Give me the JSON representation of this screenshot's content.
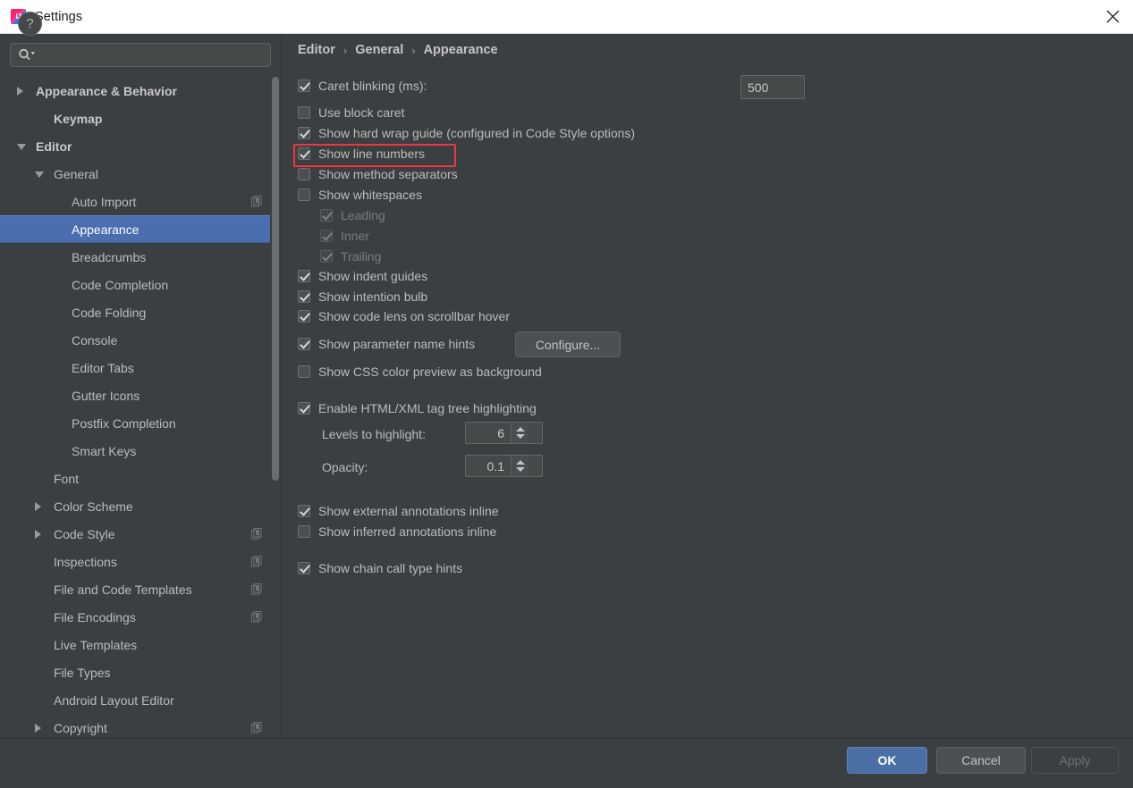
{
  "window": {
    "title": "Settings",
    "app_icon": "intellij-idea-icon",
    "close_icon": "close-icon"
  },
  "sidebar": {
    "search": {
      "placeholder": "",
      "value": "",
      "icon": "search-icon",
      "dropdown_icon": "chevron-down-icon"
    },
    "items": [
      {
        "label": "Appearance & Behavior",
        "indent": 0,
        "arrow": "right",
        "bold": true,
        "selected": false,
        "config_icon": false
      },
      {
        "label": "Keymap",
        "indent": 1,
        "arrow": "none",
        "bold": true,
        "selected": false,
        "config_icon": false
      },
      {
        "label": "Editor",
        "indent": 0,
        "arrow": "down",
        "bold": true,
        "selected": false,
        "config_icon": false
      },
      {
        "label": "General",
        "indent": 1,
        "arrow": "down",
        "bold": false,
        "selected": false,
        "config_icon": false
      },
      {
        "label": "Auto Import",
        "indent": 2,
        "arrow": "none",
        "bold": false,
        "selected": false,
        "config_icon": true
      },
      {
        "label": "Appearance",
        "indent": 2,
        "arrow": "none",
        "bold": false,
        "selected": true,
        "config_icon": false
      },
      {
        "label": "Breadcrumbs",
        "indent": 2,
        "arrow": "none",
        "bold": false,
        "selected": false,
        "config_icon": false
      },
      {
        "label": "Code Completion",
        "indent": 2,
        "arrow": "none",
        "bold": false,
        "selected": false,
        "config_icon": false
      },
      {
        "label": "Code Folding",
        "indent": 2,
        "arrow": "none",
        "bold": false,
        "selected": false,
        "config_icon": false
      },
      {
        "label": "Console",
        "indent": 2,
        "arrow": "none",
        "bold": false,
        "selected": false,
        "config_icon": false
      },
      {
        "label": "Editor Tabs",
        "indent": 2,
        "arrow": "none",
        "bold": false,
        "selected": false,
        "config_icon": false
      },
      {
        "label": "Gutter Icons",
        "indent": 2,
        "arrow": "none",
        "bold": false,
        "selected": false,
        "config_icon": false
      },
      {
        "label": "Postfix Completion",
        "indent": 2,
        "arrow": "none",
        "bold": false,
        "selected": false,
        "config_icon": false
      },
      {
        "label": "Smart Keys",
        "indent": 2,
        "arrow": "none",
        "bold": false,
        "selected": false,
        "config_icon": false
      },
      {
        "label": "Font",
        "indent": 1,
        "arrow": "none",
        "bold": false,
        "selected": false,
        "config_icon": false
      },
      {
        "label": "Color Scheme",
        "indent": 1,
        "arrow": "right",
        "bold": false,
        "selected": false,
        "config_icon": false
      },
      {
        "label": "Code Style",
        "indent": 1,
        "arrow": "right",
        "bold": false,
        "selected": false,
        "config_icon": true
      },
      {
        "label": "Inspections",
        "indent": 1,
        "arrow": "none",
        "bold": false,
        "selected": false,
        "config_icon": true
      },
      {
        "label": "File and Code Templates",
        "indent": 1,
        "arrow": "none",
        "bold": false,
        "selected": false,
        "config_icon": true
      },
      {
        "label": "File Encodings",
        "indent": 1,
        "arrow": "none",
        "bold": false,
        "selected": false,
        "config_icon": true
      },
      {
        "label": "Live Templates",
        "indent": 1,
        "arrow": "none",
        "bold": false,
        "selected": false,
        "config_icon": false
      },
      {
        "label": "File Types",
        "indent": 1,
        "arrow": "none",
        "bold": false,
        "selected": false,
        "config_icon": false
      },
      {
        "label": "Android Layout Editor",
        "indent": 1,
        "arrow": "none",
        "bold": false,
        "selected": false,
        "config_icon": false
      },
      {
        "label": "Copyright",
        "indent": 1,
        "arrow": "right",
        "bold": false,
        "selected": false,
        "config_icon": true
      }
    ]
  },
  "main": {
    "breadcrumb": {
      "parts": [
        "Editor",
        "General",
        "Appearance"
      ],
      "separator": "›"
    },
    "caret_blinking": {
      "label": "Caret blinking (ms):",
      "checked": true,
      "value": "500"
    },
    "options": [
      {
        "label": "Use block caret",
        "checked": false,
        "enabled": true
      },
      {
        "label": "Show hard wrap guide (configured in Code Style options)",
        "checked": true,
        "enabled": true
      },
      {
        "label": "Show line numbers",
        "checked": true,
        "enabled": true,
        "highlighted": true
      },
      {
        "label": "Show method separators",
        "checked": false,
        "enabled": true
      },
      {
        "label": "Show whitespaces",
        "checked": false,
        "enabled": true
      },
      {
        "label": "Leading",
        "checked": true,
        "enabled": false
      },
      {
        "label": "Inner",
        "checked": true,
        "enabled": false
      },
      {
        "label": "Trailing",
        "checked": true,
        "enabled": false
      },
      {
        "label": "Show indent guides",
        "checked": true,
        "enabled": true
      },
      {
        "label": "Show intention bulb",
        "checked": true,
        "enabled": true
      },
      {
        "label": "Show code lens on scrollbar hover",
        "checked": true,
        "enabled": true
      }
    ],
    "parameter_hints": {
      "label": "Show parameter name hints",
      "checked": true,
      "button": "Configure..."
    },
    "css_color_preview": {
      "label": "Show CSS color preview as background",
      "checked": false
    },
    "tag_tree": {
      "label": "Enable HTML/XML tag tree highlighting",
      "checked": true,
      "levels_label": "Levels to highlight:",
      "levels_value": "6",
      "opacity_label": "Opacity:",
      "opacity_value": "0.1"
    },
    "annotations": [
      {
        "label": "Show external annotations inline",
        "checked": true
      },
      {
        "label": "Show inferred annotations inline",
        "checked": false
      }
    ],
    "chain_call": {
      "label": "Show chain call type hints",
      "checked": true
    }
  },
  "footer": {
    "help_label": "?",
    "ok_label": "OK",
    "cancel_label": "Cancel",
    "apply_label": "Apply"
  },
  "colors": {
    "accent": "#4a6fa5",
    "selection": "#4b6eaf",
    "highlight": "#e8393c",
    "background": "#3c3f41"
  }
}
